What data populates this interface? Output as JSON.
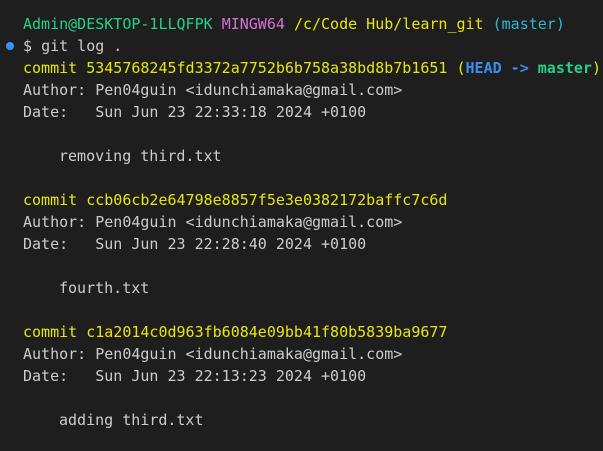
{
  "prompt": {
    "user_host": "Admin@DESKTOP-1LLQFPK",
    "system": "MINGW64",
    "path": "/c/Code Hub/learn_git",
    "branch": "(master)"
  },
  "command": {
    "symbol": "$",
    "text": "git log ."
  },
  "ref_decoration": {
    "open": "(",
    "head": "HEAD",
    "arrow": "->",
    "branch": "master",
    "close": ")"
  },
  "commits": [
    {
      "label": "commit",
      "hash": "5345768245fd3372a7752b6b758a38bd8b7b1651",
      "author_label": "Author:",
      "author": "Pen04guin <idunchiamaka@gmail.com>",
      "date_label": "Date:",
      "date": "Sun Jun 23 22:33:18 2024 +0100",
      "message": "removing third.txt"
    },
    {
      "label": "commit",
      "hash": "ccb06cb2e64798e8857f5e3e0382172baffc7c6d",
      "author_label": "Author:",
      "author": "Pen04guin <idunchiamaka@gmail.com>",
      "date_label": "Date:",
      "date": "Sun Jun 23 22:28:40 2024 +0100",
      "message": "fourth.txt"
    },
    {
      "label": "commit",
      "hash": "c1a2014c0d963fb6084e09bb41f80b5839ba9677",
      "author_label": "Author:",
      "author": "Pen04guin <idunchiamaka@gmail.com>",
      "date_label": "Date:",
      "date": "Sun Jun 23 22:13:23 2024 +0100",
      "message": "adding third.txt"
    }
  ],
  "colors": {
    "background": "#1e1e1e",
    "user_host": "#23d18b",
    "system": "#d670d6",
    "path": "#e5e510",
    "branch": "#29b8db",
    "commit": "#e5e510",
    "head": "#3b8eea",
    "decoration_dot": "#3794ff"
  }
}
